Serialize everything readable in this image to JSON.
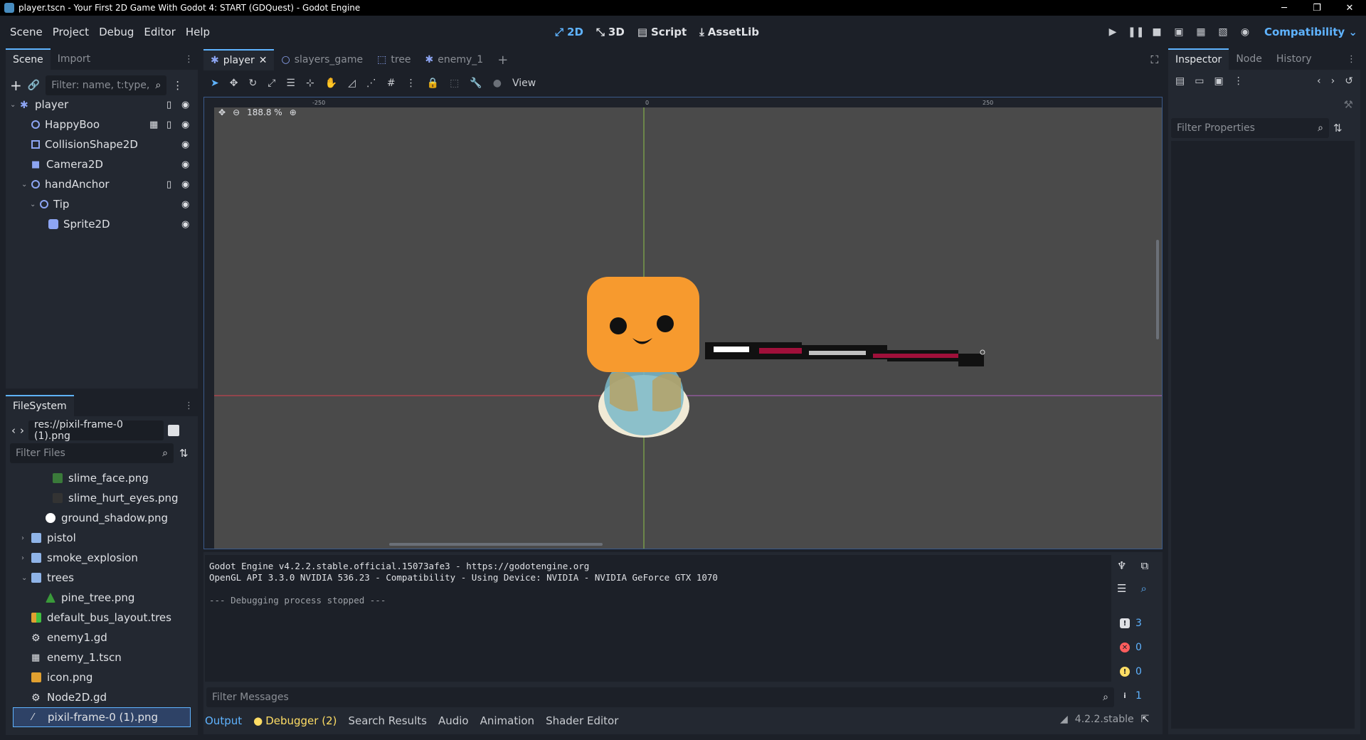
{
  "window": {
    "title": "player.tscn - Your First 2D Game With Godot 4: START (GDQuest) - Godot Engine"
  },
  "menu": [
    "Scene",
    "Project",
    "Debug",
    "Editor",
    "Help"
  ],
  "main_buttons": [
    {
      "label": "2D",
      "active": true
    },
    {
      "label": "3D",
      "active": false
    },
    {
      "label": "Script",
      "active": false
    },
    {
      "label": "AssetLib",
      "active": false
    }
  ],
  "renderer": "Compatibility",
  "scene_dock": {
    "tabs": [
      "Scene",
      "Import"
    ],
    "filter_placeholder": "Filter: name, t:type,",
    "nodes": [
      {
        "name": "player",
        "depth": 0,
        "icon_color": "#8da5f3"
      },
      {
        "name": "HappyBoo",
        "depth": 1,
        "icon_color": "#8da5f3"
      },
      {
        "name": "CollisionShape2D",
        "depth": 1,
        "icon_color": "#8da5f3"
      },
      {
        "name": "Camera2D",
        "depth": 1,
        "icon_color": "#8da5f3"
      },
      {
        "name": "handAnchor",
        "depth": 1,
        "icon_color": "#8da5f3"
      },
      {
        "name": "Tip",
        "depth": 2,
        "icon_color": "#8da5f3"
      },
      {
        "name": "Sprite2D",
        "depth": 3,
        "icon_color": "#8da5f3"
      }
    ]
  },
  "filesystem": {
    "title": "FileSystem",
    "path": "res://pixil-frame-0 (1).png",
    "filter_placeholder": "Filter Files",
    "items": [
      {
        "name": "slime_face.png",
        "depth": 2
      },
      {
        "name": "slime_hurt_eyes.png",
        "depth": 2
      },
      {
        "name": "ground_shadow.png",
        "depth": 1
      },
      {
        "name": "pistol",
        "depth": 0
      },
      {
        "name": "smoke_explosion",
        "depth": 0
      },
      {
        "name": "trees",
        "depth": 0
      },
      {
        "name": "pine_tree.png",
        "depth": 1
      },
      {
        "name": "default_bus_layout.tres",
        "depth": 0
      },
      {
        "name": "enemy1.gd",
        "depth": 0
      },
      {
        "name": "enemy_1.tscn",
        "depth": 0
      },
      {
        "name": "icon.png",
        "depth": 0
      },
      {
        "name": "Node2D.gd",
        "depth": 0
      },
      {
        "name": "pixil-frame-0 (1).png",
        "depth": 0
      }
    ]
  },
  "editor_tabs": [
    "player",
    "slayers_game",
    "tree",
    "enemy_1"
  ],
  "viewport": {
    "zoom": "188.8 %",
    "view_label": "View",
    "ruler_marks": [
      "-250",
      "0",
      "250"
    ]
  },
  "console": {
    "lines": [
      "Godot Engine v4.2.2.stable.official.15073afe3 - https://godotengine.org",
      "OpenGL API 3.3.0 NVIDIA 536.23 - Compatibility - Using Device: NVIDIA - NVIDIA GeForce GTX 1070",
      "",
      "--- Debugging process stopped ---"
    ],
    "filter_placeholder": "Filter Messages",
    "counts": {
      "messages": "3",
      "errors": "0",
      "warnings": "0",
      "info": "1"
    }
  },
  "bottom_tabs": [
    "Output",
    "Debugger (2)",
    "Search Results",
    "Audio",
    "Animation",
    "Shader Editor"
  ],
  "version": "4.2.2.stable",
  "inspector": {
    "tabs": [
      "Inspector",
      "Node",
      "History"
    ],
    "filter_placeholder": "Filter Properties"
  },
  "colors": {
    "accent": "#5fb3ff",
    "node_icon": "#8da5f3",
    "folder": "#8fb4e8"
  }
}
